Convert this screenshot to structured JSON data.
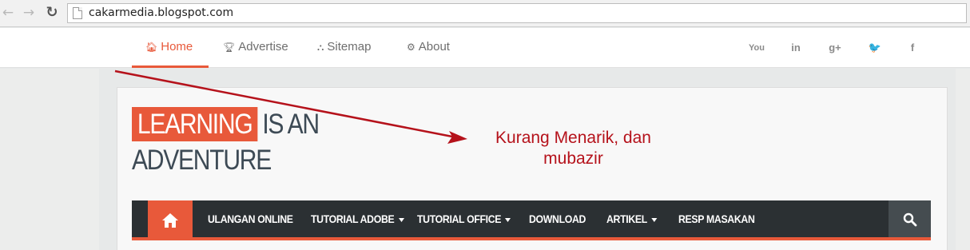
{
  "browser": {
    "url": "cakarmedia.blogspot.com",
    "back_icon": "arrow-left-icon",
    "forward_icon": "arrow-right-icon",
    "reload_icon": "reload-icon",
    "page_icon": "page-icon"
  },
  "top_menu": {
    "items": [
      {
        "label": "Home",
        "icon": "home-icon"
      },
      {
        "label": "Advertise",
        "icon": "trophy-icon"
      },
      {
        "label": "Sitemap",
        "icon": "sitemap-icon"
      },
      {
        "label": "About",
        "icon": "gear-icon"
      }
    ],
    "active_index": 0,
    "social": [
      {
        "icon": "youtube-icon",
        "glyph": "You"
      },
      {
        "icon": "linkedin-icon",
        "glyph": "in"
      },
      {
        "icon": "google-plus-icon",
        "glyph": "g+"
      },
      {
        "icon": "twitter-icon",
        "glyph": "🐦"
      },
      {
        "icon": "facebook-icon",
        "glyph": "f"
      }
    ]
  },
  "logo": {
    "highlight": "LEARNING",
    "rest_line1": "IS AN",
    "line2": "ADVENTURE"
  },
  "main_menu": {
    "home_icon": "home-icon",
    "items": [
      {
        "label": "ULANGAN ONLINE",
        "dropdown": false
      },
      {
        "label": "TUTORIAL ADOBE",
        "dropdown": true
      },
      {
        "label": "TUTORIAL OFFICE",
        "dropdown": true
      },
      {
        "label": "DOWNLOAD",
        "dropdown": false
      },
      {
        "label": "ARTIKEL",
        "dropdown": true
      },
      {
        "label": "RESP MASAKAN",
        "dropdown": false
      }
    ],
    "search_icon": "search-icon"
  },
  "annotation": {
    "line1": "Kurang Menarik, dan",
    "line2": "mubazir"
  },
  "colors": {
    "accent": "#e8593a",
    "menu_bg": "#2b3033",
    "logo_text": "#3d4a55",
    "annotation": "#b5121b"
  }
}
